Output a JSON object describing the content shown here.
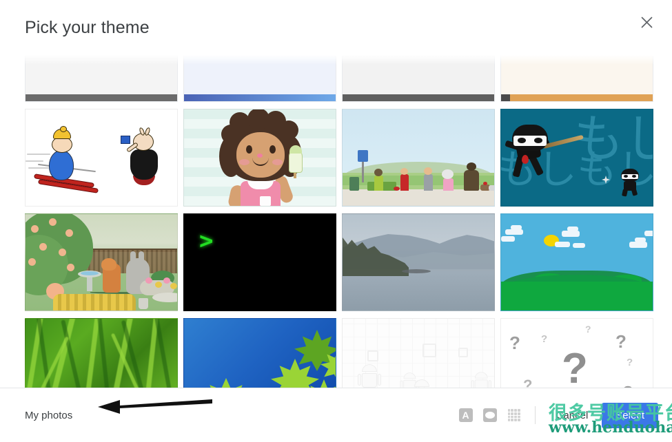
{
  "dialog": {
    "title": "Pick your theme",
    "close_icon": "close-icon"
  },
  "themes": {
    "partial_row_top": [
      {
        "name": "dark-doc-partial",
        "stripe": "#6b6b6b"
      },
      {
        "name": "blue-gradient-partial",
        "stripe": "#5b86d6"
      },
      {
        "name": "gray-partial",
        "stripe": "#5f5f5f"
      },
      {
        "name": "orange-partial",
        "stripe": "#e0a255"
      }
    ],
    "items": [
      {
        "name": "cartoon-skier",
        "label": "Cartoon skier and flag bearer"
      },
      {
        "name": "girl-ice-cream",
        "label": "Girl with ice cream on mint stripes"
      },
      {
        "name": "park-bus-stop",
        "label": "Park bus stop scene with people"
      },
      {
        "name": "ninja-teal",
        "label": "Ninjas on teal with Japanese kana",
        "kana_a": "もしもし",
        "kana_b": "もし"
      },
      {
        "name": "garden-fox",
        "label": "Garden with fruit tree and fox"
      },
      {
        "name": "terminal-green",
        "label": "Black terminal with green prompt",
        "prompt": ">"
      },
      {
        "name": "misty-lake",
        "label": "Misty lake with forested shoreline"
      },
      {
        "name": "pixel-landscape",
        "label": "Pixel art landscape with sun and hills"
      },
      {
        "name": "grass-closeup",
        "label": "Close-up green grass blades"
      },
      {
        "name": "maple-leaves-sky",
        "label": "Maple leaves against blue sky"
      },
      {
        "name": "android-circuit",
        "label": "Android robots on circuit board"
      },
      {
        "name": "question-marks",
        "label": "Scattered question marks"
      }
    ]
  },
  "footer": {
    "my_photos_label": "My photos",
    "tools": [
      {
        "name": "text-color-icon",
        "glyph": "A"
      },
      {
        "name": "background-shape-icon",
        "glyph": ""
      },
      {
        "name": "more-options-grid-icon",
        "glyph": ""
      }
    ],
    "cancel_label": "Cancel",
    "select_label": "Select"
  },
  "watermark": {
    "cn_text": "很多号账号平台",
    "url_text": "www.henduohao.com",
    "cn_color": "#46c8a0",
    "url_color": "#1f9c7a"
  },
  "annotation": {
    "arrow_name": "pointer-arrow-annotation",
    "arrow_color": "#111111"
  },
  "colors": {
    "accent": "#3b78e7",
    "title": "#3c4043"
  }
}
